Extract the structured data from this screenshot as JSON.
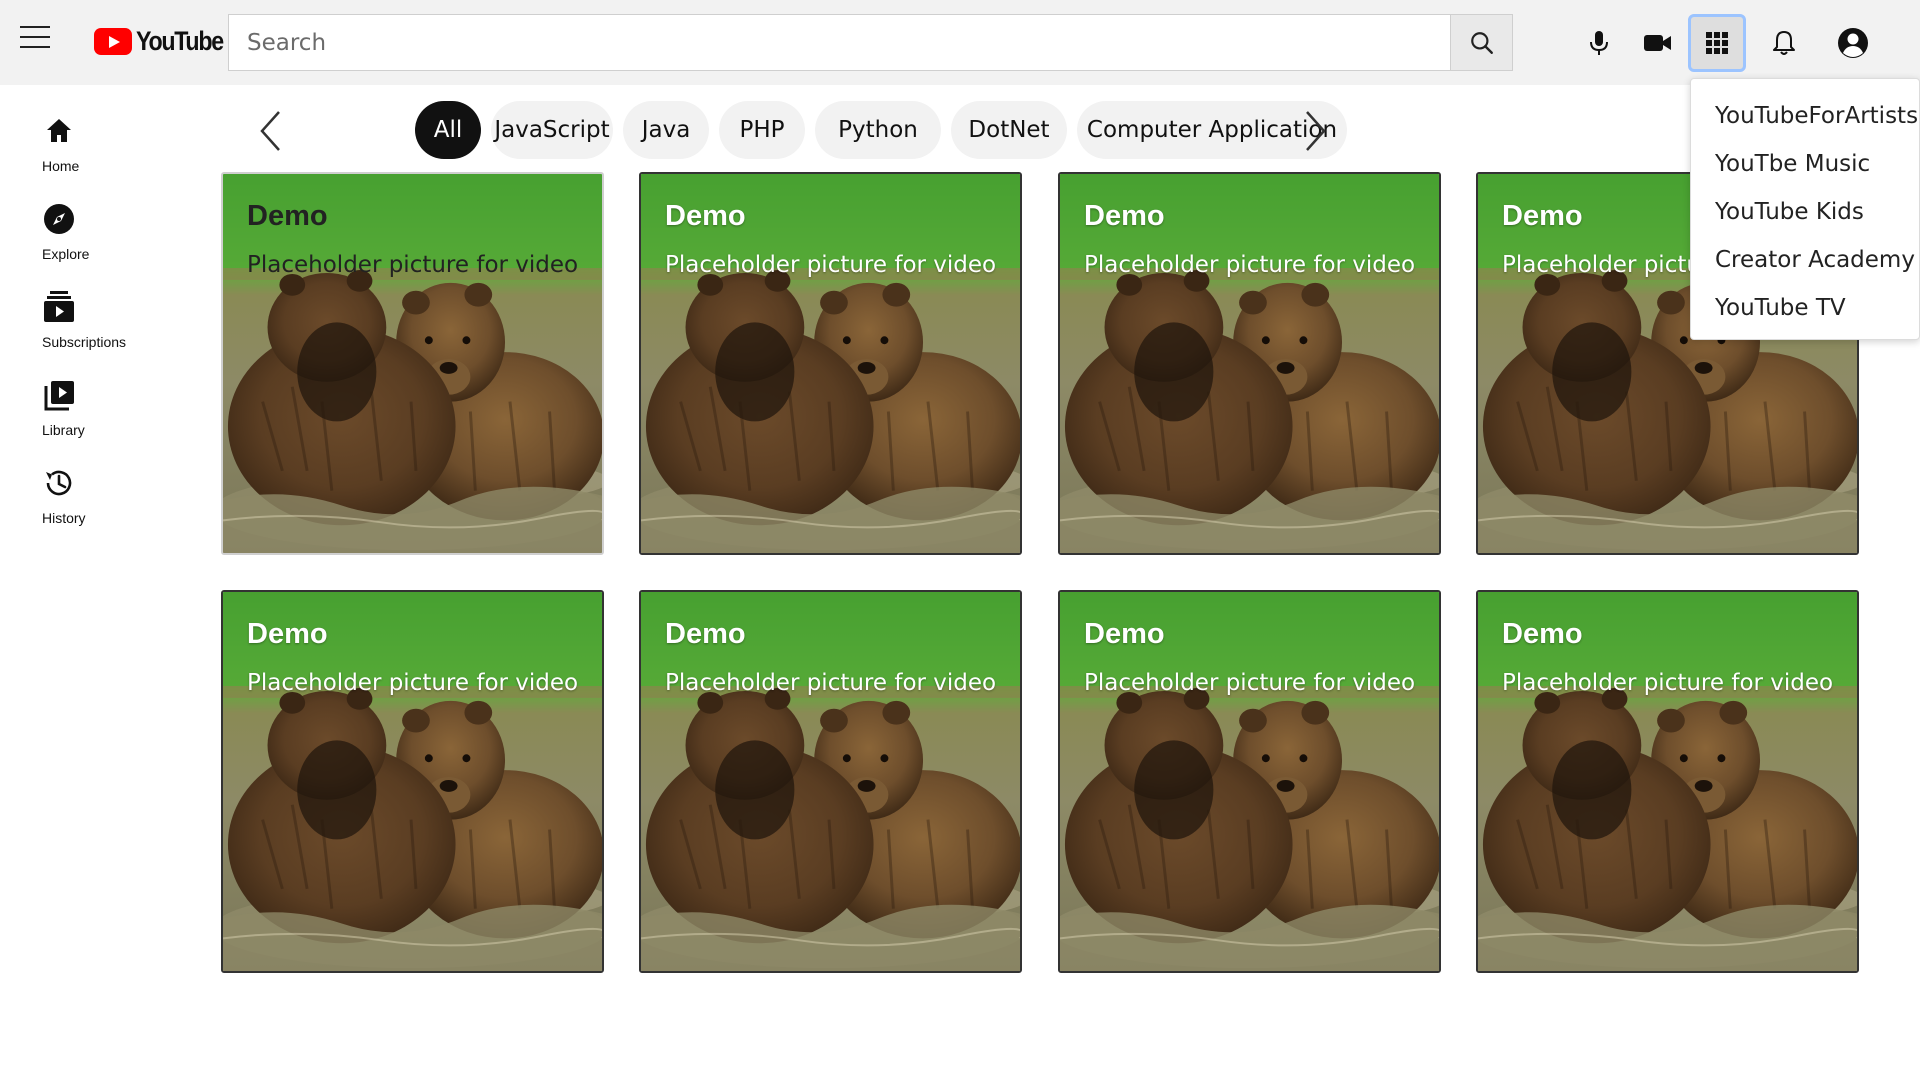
{
  "header": {
    "logo_text": "YouTube",
    "search_placeholder": "Search",
    "search_value": ""
  },
  "icons": {
    "menu": "hamburger-icon",
    "search": "search-icon",
    "mic": "microphone-icon",
    "camera": "video-camera-icon",
    "apps": "apps-grid-icon",
    "bell": "bell-icon",
    "account": "account-circle-icon"
  },
  "sidebar": {
    "items": [
      {
        "label": "Home",
        "icon": "home-icon"
      },
      {
        "label": "Explore",
        "icon": "compass-icon"
      },
      {
        "label": "Subscriptions",
        "icon": "subscriptions-icon"
      },
      {
        "label": "Library",
        "icon": "library-icon"
      },
      {
        "label": "History",
        "icon": "history-icon"
      }
    ]
  },
  "chips": [
    {
      "label": "All",
      "active": true
    },
    {
      "label": "JavaScript"
    },
    {
      "label": "Java"
    },
    {
      "label": "PHP"
    },
    {
      "label": "Python"
    },
    {
      "label": "DotNet"
    },
    {
      "label": "Computer Application"
    }
  ],
  "videos": [
    {
      "title": "Demo",
      "description": "Placeholder picture for video"
    },
    {
      "title": "Demo",
      "description": "Placeholder picture for video"
    },
    {
      "title": "Demo",
      "description": "Placeholder picture for video"
    },
    {
      "title": "Demo",
      "description": "Placeholder picture for video"
    },
    {
      "title": "Demo",
      "description": "Placeholder picture for video"
    },
    {
      "title": "Demo",
      "description": "Placeholder picture for video"
    },
    {
      "title": "Demo",
      "description": "Placeholder picture for video"
    },
    {
      "title": "Demo",
      "description": "Placeholder picture for video"
    }
  ],
  "apps_menu": {
    "items": [
      "YouTubeForArtists",
      "YouTbe Music",
      "YouTube Kids",
      "Creator Academy",
      "YouTube TV"
    ]
  },
  "colors": {
    "brand_red": "#ff0000",
    "header_bg": "#f2f2f2",
    "chip_active": "#111111",
    "chip_bg": "#f2f2f2",
    "apps_highlight_border": "#9cc4ff"
  }
}
